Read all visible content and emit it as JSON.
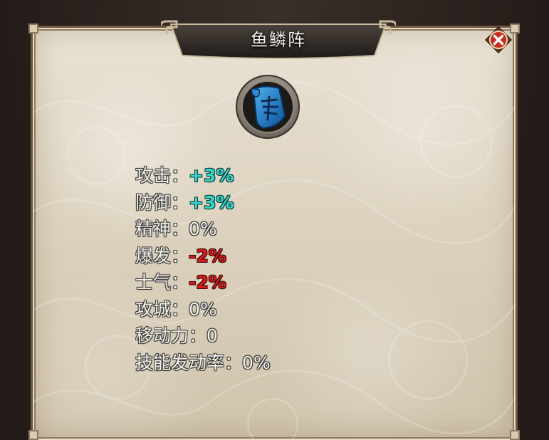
{
  "dialog": {
    "title": "鱼鳞阵",
    "icon": "scroll-icon",
    "close_icon": "close-icon"
  },
  "stats": [
    {
      "label": "攻击：",
      "value": "+3%",
      "tone": "positive"
    },
    {
      "label": "防御：",
      "value": "+3%",
      "tone": "positive"
    },
    {
      "label": "精神：",
      "value": "0%",
      "tone": "neutral"
    },
    {
      "label": "爆发：",
      "value": "-2%",
      "tone": "negative"
    },
    {
      "label": "士气：",
      "value": "-2%",
      "tone": "negative"
    },
    {
      "label": "攻城：",
      "value": "0%",
      "tone": "neutral"
    },
    {
      "label": "移动力：",
      "value": "0",
      "tone": "neutral"
    },
    {
      "label": "技能发动率：",
      "value": "0%",
      "tone": "neutral"
    }
  ],
  "colors": {
    "positive": "#35d6c8",
    "negative": "#d41b1b",
    "neutral": "#f5f1ea",
    "banner": "#2e2a27",
    "close": "#c8281e"
  }
}
